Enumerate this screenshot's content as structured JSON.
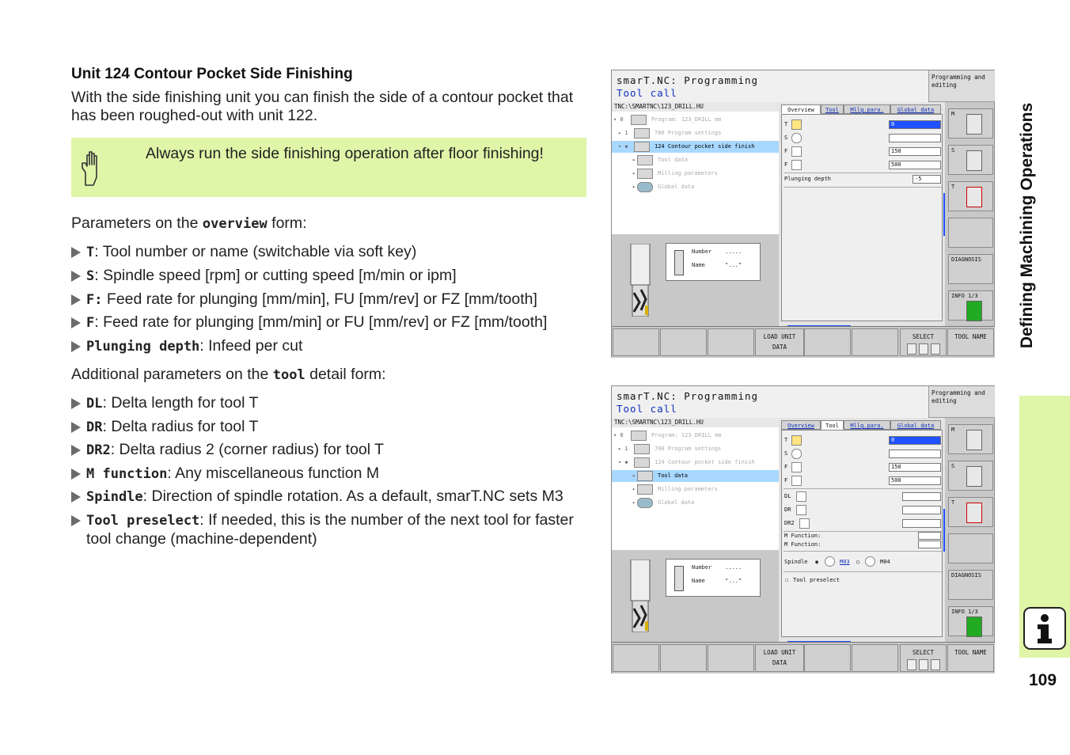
{
  "heading": "Unit 124 Contour Pocket Side Finishing",
  "intro": "With the side finishing unit you can finish the side of a contour pocket that has been roughed-out with unit 122.",
  "note": {
    "icon": "pointing-hand-icon",
    "text": "Always run the side finishing operation after floor finishing!"
  },
  "overview_para": {
    "prefix": "Parameters on the ",
    "keyword": "overview",
    "suffix": " form:"
  },
  "overview_params": [
    {
      "key": "T",
      "desc": ": Tool number or name (switchable via soft key)"
    },
    {
      "key": "S",
      "desc": ": Spindle speed [rpm] or cutting speed [m/min or ipm]"
    },
    {
      "key": "F:",
      "desc": " Feed rate for plunging [mm/min], FU [mm/rev] or FZ [mm/tooth]"
    },
    {
      "key": "F",
      "desc": ": Feed rate for plunging [mm/min] or FU [mm/rev] or FZ [mm/tooth]"
    },
    {
      "key": "Plunging depth",
      "desc": ": Infeed per cut"
    }
  ],
  "tool_para": {
    "prefix": "Additional parameters on the ",
    "keyword": "tool",
    "suffix": " detail form:"
  },
  "tool_params": [
    {
      "key": "DL",
      "desc": ": Delta length for tool T"
    },
    {
      "key": "DR",
      "desc": ": Delta radius for tool T"
    },
    {
      "key": "DR2",
      "desc": ": Delta radius 2 (corner radius) for tool T"
    },
    {
      "key": "M function",
      "desc": ": Any miscellaneous function M"
    },
    {
      "key": "Spindle",
      "desc": ": Direction of spindle rotation. As a default, smarT.NC sets M3"
    },
    {
      "key": "Tool preselect",
      "desc": ": If needed, this is the number of the next tool for faster tool change (machine-dependent)"
    }
  ],
  "side_title": "Defining Machining Operations",
  "page_number": "109",
  "info_icon": "info-icon",
  "screens": [
    {
      "title": "smarT.NC: Programming",
      "subtitle": "Tool call",
      "mode": "Programming and editing",
      "path": "TNC:\\SMARTNC\\123_DRILL.HU",
      "tree": [
        {
          "label": "Program: 123_DRILL mm",
          "state": "dim"
        },
        {
          "label": "700 Program settings",
          "state": "dim"
        },
        {
          "label": "124 Contour pocket side finish",
          "state": "selected"
        },
        {
          "label": "Tool data",
          "state": "dim"
        },
        {
          "label": "Milling parameters",
          "state": "dim"
        },
        {
          "label": "Global data",
          "state": "dim"
        }
      ],
      "tool_info": {
        "number_label": "Number",
        "number_value": ".....",
        "name_label": "Name",
        "name_value": "\"...\""
      },
      "tabs": [
        "Overview",
        "Tool",
        "Mllg.para.",
        "Global data"
      ],
      "active_tab": 0,
      "fields": [
        {
          "key": "T",
          "value": "0",
          "highlight": true
        },
        {
          "key": "S",
          "value": ""
        },
        {
          "key": "F",
          "value": "150"
        },
        {
          "key": "F",
          "value": "500"
        }
      ],
      "extra_label": "Plunging depth",
      "extra_value": "-5",
      "vkeys": [
        "M",
        "S",
        "T",
        "",
        "DIAGNOSIS",
        "INFO 1/3"
      ],
      "hkeys": [
        "",
        "",
        "",
        "LOAD UNIT DATA",
        "",
        "",
        "SELECT",
        "TOOL NAME"
      ]
    },
    {
      "title": "smarT.NC: Programming",
      "subtitle": "Tool call",
      "mode": "Programming and editing",
      "path": "TNC:\\SMARTNC\\123_DRILL.HU",
      "tree": [
        {
          "label": "Program: 123_DRILL mm",
          "state": "dim"
        },
        {
          "label": "700 Program settings",
          "state": "dim"
        },
        {
          "label": "124 Contour pocket side finish",
          "state": "dim"
        },
        {
          "label": "Tool data",
          "state": "selected"
        },
        {
          "label": "Milling parameters",
          "state": "dim"
        },
        {
          "label": "Global data",
          "state": "dim"
        }
      ],
      "tool_info": {
        "number_label": "Number",
        "number_value": ".....",
        "name_label": "Name",
        "name_value": "\"...\""
      },
      "tabs": [
        "Overview",
        "Tool",
        "Mllg.para.",
        "Global data"
      ],
      "active_tab": 1,
      "fields": [
        {
          "key": "T",
          "value": "0",
          "highlight": true
        },
        {
          "key": "S",
          "value": ""
        },
        {
          "key": "F",
          "value": "150"
        },
        {
          "key": "F",
          "value": "500"
        },
        {
          "key": "DL",
          "value": ""
        },
        {
          "key": "DR",
          "value": ""
        },
        {
          "key": "DR2",
          "value": ""
        }
      ],
      "m_function_label": "M Function:",
      "spindle_label": "Spindle",
      "spindle_opt1": "M03",
      "spindle_opt2": "M04",
      "preselect_label": "Tool preselect",
      "vkeys": [
        "M",
        "S",
        "T",
        "",
        "DIAGNOSIS",
        "INFO 1/3"
      ],
      "hkeys": [
        "",
        "",
        "",
        "LOAD UNIT DATA",
        "",
        "",
        "SELECT",
        "TOOL NAME"
      ]
    }
  ]
}
